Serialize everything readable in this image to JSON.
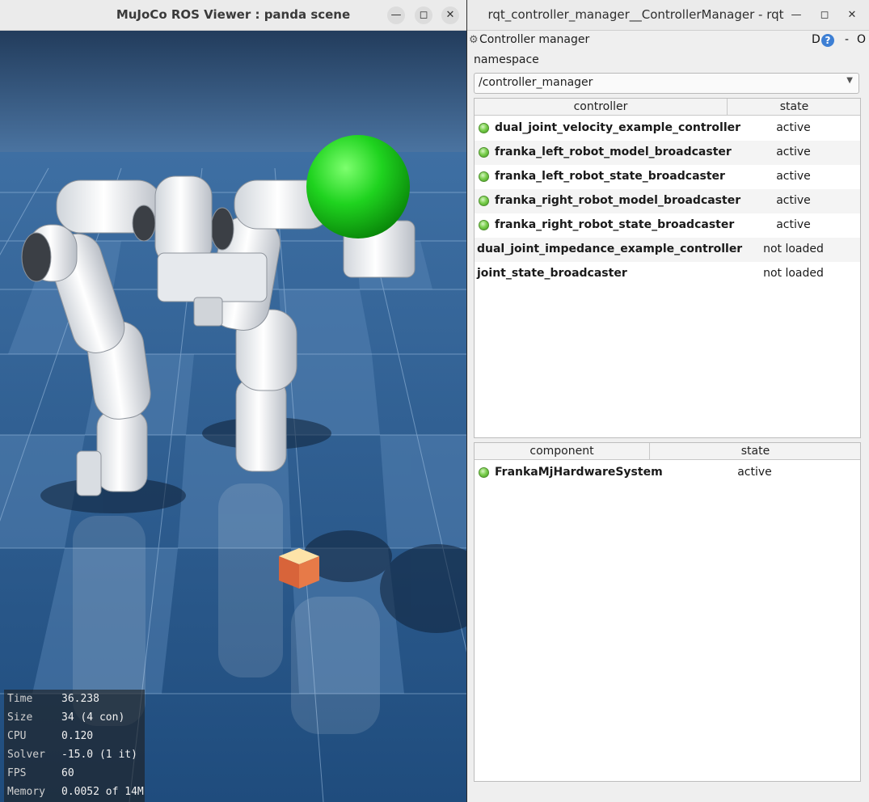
{
  "mujoco_window": {
    "title": "MuJoCo ROS Viewer : panda scene",
    "buttons": {
      "minimize": "—",
      "maximize": "◻",
      "close": "✕"
    },
    "stats": [
      {
        "label": "Time",
        "value": "36.238"
      },
      {
        "label": "Size",
        "value": "34  (4 con)"
      },
      {
        "label": "CPU",
        "value": "0.120"
      },
      {
        "label": "Solver",
        "value": "-15.0  (1 it)"
      },
      {
        "label": "FPS",
        "value": "60"
      },
      {
        "label": "Memory",
        "value": "0.0052 of 14M"
      }
    ]
  },
  "rqt_window": {
    "title": "rqt_controller_manager__ControllerManager - rqt",
    "buttons": {
      "minimize": "—",
      "maximize": "◻",
      "close": "✕"
    },
    "panel": {
      "title": "Controller manager",
      "d_label": "D",
      "help_label": "?",
      "dash_label": "-",
      "o_label": "O"
    },
    "namespace": {
      "label": "namespace",
      "value": "/controller_manager"
    },
    "controllers_table": {
      "headers": [
        "controller",
        "state"
      ],
      "rows": [
        {
          "name": "dual_joint_velocity_example_controller",
          "state": "active",
          "indicator": "green"
        },
        {
          "name": "franka_left_robot_model_broadcaster",
          "state": "active",
          "indicator": "green"
        },
        {
          "name": "franka_left_robot_state_broadcaster",
          "state": "active",
          "indicator": "green"
        },
        {
          "name": "franka_right_robot_model_broadcaster",
          "state": "active",
          "indicator": "green"
        },
        {
          "name": "franka_right_robot_state_broadcaster",
          "state": "active",
          "indicator": "green"
        },
        {
          "name": "dual_joint_impedance_example_controller",
          "state": "not loaded",
          "indicator": "none"
        },
        {
          "name": "joint_state_broadcaster",
          "state": "not loaded",
          "indicator": "none"
        }
      ]
    },
    "components_table": {
      "headers": [
        "component",
        "state"
      ],
      "rows": [
        {
          "name": "FrankaMjHardwareSystem",
          "state": "active",
          "indicator": "green"
        }
      ]
    }
  },
  "colors": {
    "active_led": "#6cc43f",
    "sky": "#3a5a80",
    "floor": "#2d5f96",
    "sphere": "#1ed31e",
    "cube": "#e07b4f"
  }
}
